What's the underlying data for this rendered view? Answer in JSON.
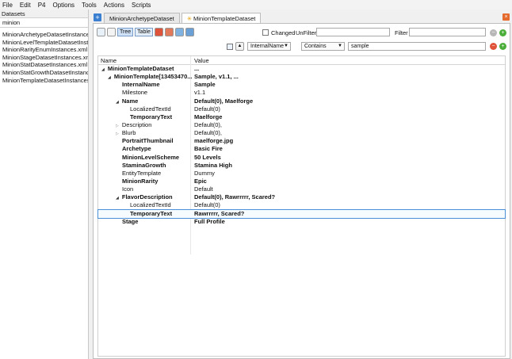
{
  "menu": [
    "File",
    "Edit",
    "P4",
    "Options",
    "Tools",
    "Actions",
    "Scripts"
  ],
  "datasets": {
    "header": "Datasets",
    "filter_value": "minion",
    "items": [
      "MinionArchetypeDatasetInstances...",
      "MinionLevelTemplateDatasetInsta...",
      "MinionRarityEnumInstances.xml",
      "MinionStageDatasetInstances.xml",
      "MinionStatDatasetInstances.xml",
      "MinionStatGrowthDatasetInstance...",
      "MinionTemplateDatasetInstances..."
    ]
  },
  "tabs": [
    {
      "label": "MinionArchetypeDataset"
    },
    {
      "label": "MinionTemplateDataset"
    }
  ],
  "toolbar": {
    "tree_label": "Tree",
    "table_label": "Table",
    "changed_label": "Changed",
    "unfilter_label": "UnFilter",
    "filter_label": "Filter",
    "field_value": "InternalName",
    "operator_value": "Contains",
    "search_value": "sample"
  },
  "grid": {
    "col_name": "Name",
    "col_value": "Value",
    "rows": [
      {
        "name": "MinionTemplateDataset",
        "value": "...",
        "bold": true,
        "toggle": "open"
      },
      {
        "name": "MinionTemplate[13453470...",
        "value": "Sample, v1.1, ...",
        "bold": true,
        "toggle": "open"
      },
      {
        "name": "InternalName",
        "value": "Sample",
        "bold": true,
        "toggle": ""
      },
      {
        "name": "Milestone",
        "value": "v1.1",
        "bold": false,
        "toggle": ""
      },
      {
        "name": "Name",
        "value": "Default(0), Maelforge",
        "bold": true,
        "toggle": "open"
      },
      {
        "name": "LocalizedTextId",
        "value": "Default(0)",
        "bold": false,
        "toggle": ""
      },
      {
        "name": "TemporaryText",
        "value": "Maelforge",
        "bold": true,
        "toggle": ""
      },
      {
        "name": "Description",
        "value": "Default(0),",
        "bold": false,
        "toggle": "closed"
      },
      {
        "name": "Blurb",
        "value": "Default(0),",
        "bold": false,
        "toggle": "closed"
      },
      {
        "name": "PortraitThumbnail",
        "value": "maelforge.jpg",
        "bold": true,
        "toggle": ""
      },
      {
        "name": "Archetype",
        "value": "Basic Fire",
        "bold": true,
        "toggle": ""
      },
      {
        "name": "MinionLevelScheme",
        "value": "50 Levels",
        "bold": true,
        "toggle": ""
      },
      {
        "name": "StaminaGrowth",
        "value": "Stamina High",
        "bold": true,
        "toggle": ""
      },
      {
        "name": "EntityTemplate",
        "value": "Dummy",
        "bold": false,
        "toggle": ""
      },
      {
        "name": "MinionRarity",
        "value": "Epic",
        "bold": true,
        "toggle": ""
      },
      {
        "name": "Icon",
        "value": "Default",
        "bold": false,
        "toggle": ""
      },
      {
        "name": "FlavorDescription",
        "value": "Default(0), Rawrrrrr, Scared?",
        "bold": true,
        "toggle": "open"
      },
      {
        "name": "LocalizedTextId",
        "value": "Default(0)",
        "bold": false,
        "toggle": ""
      },
      {
        "name": "TemporaryText",
        "value": "Rawrrrrr, Scared?",
        "bold": true,
        "toggle": "",
        "selected": true
      },
      {
        "name": "Stage",
        "value": "Full Profile",
        "bold": true,
        "toggle": ""
      }
    ]
  },
  "colors": {
    "accent": "#3b7fd0",
    "close": "#e46a2e",
    "remove": "#e0533b",
    "add": "#4cae3a"
  }
}
